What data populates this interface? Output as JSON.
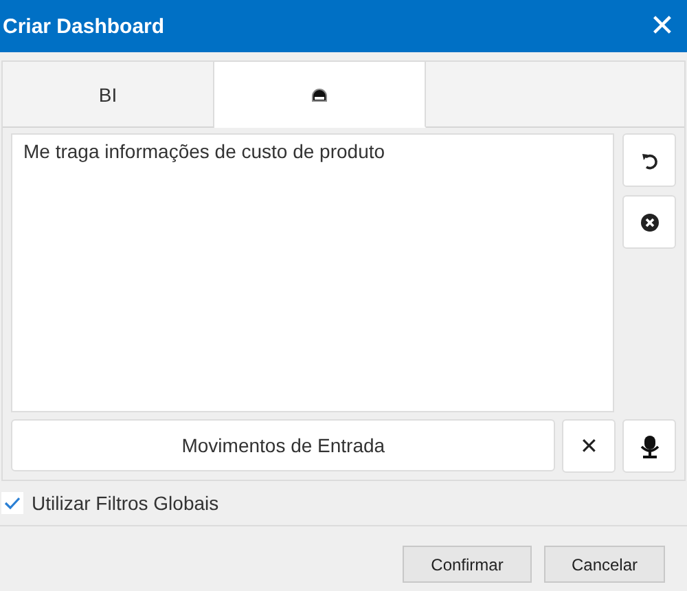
{
  "window": {
    "title": "Criar Dashboard",
    "close": "✕"
  },
  "tabs": [
    {
      "kind": "text",
      "label": "BI",
      "selected": false
    },
    {
      "kind": "icon",
      "selected": true
    },
    {
      "kind": "blank",
      "selected": false
    }
  ],
  "prompt": {
    "value": "Me traga informações de custo de produto"
  },
  "source": {
    "value": "Movimentos de Entrada",
    "clear": "✕"
  },
  "global_filters": {
    "label": "Utilizar Filtros Globais",
    "checked": true
  },
  "buttons": [
    "Confirmar",
    "Cancelar"
  ]
}
